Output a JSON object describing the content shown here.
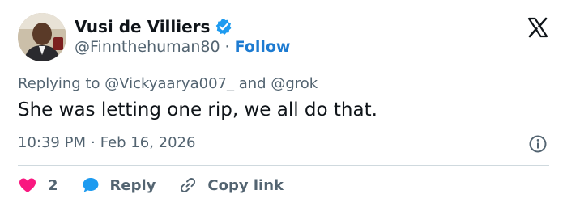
{
  "author": {
    "name": "Vusi de Villiers",
    "handle": "@Finnthehuman80",
    "separator": "·",
    "follow_label": "Follow"
  },
  "reply_context": {
    "prefix": "Replying to",
    "mention_1": "@Vickyaarya007_",
    "conjunction": "and",
    "mention_2": "@grok"
  },
  "tweet": {
    "text": "She was letting one rip, we all do that.",
    "time": "10:39 PM",
    "date_separator": "·",
    "date": "Feb 16, 2026"
  },
  "actions": {
    "like_count": "2",
    "reply_label": "Reply",
    "copy_label": "Copy link"
  },
  "icons": {
    "verified": "verified-badge-icon",
    "brand": "x-logo-icon",
    "info": "info-icon",
    "like": "heart-icon",
    "reply": "speech-bubble-icon",
    "copy": "link-icon"
  },
  "colors": {
    "verified": "#1d9bf0",
    "follow": "#1d7bd1",
    "like": "#f91880",
    "reply": "#1d9bf0",
    "muted": "#536471",
    "text": "#0f1419"
  }
}
